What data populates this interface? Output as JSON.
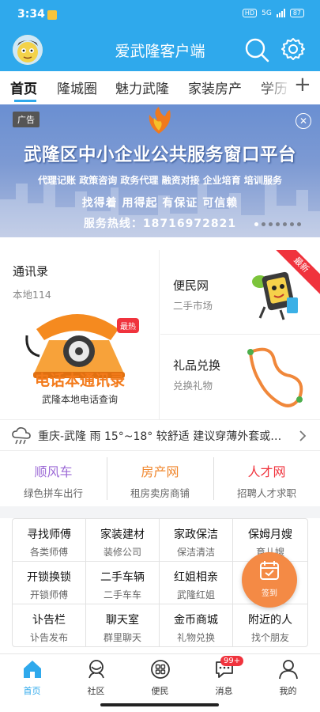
{
  "status_bar": {
    "time": "3:34",
    "network": "HD",
    "signal": "5G",
    "battery": "87"
  },
  "header": {
    "title": "爱武隆客户端"
  },
  "tabs": [
    {
      "label": "首页",
      "active": true
    },
    {
      "label": "隆城圈"
    },
    {
      "label": "魅力武隆"
    },
    {
      "label": "家装房产"
    },
    {
      "label": "学历"
    }
  ],
  "banner": {
    "ad_tag": "广告",
    "title": "武隆区中小企业公共服务窗口平台",
    "services": "代理记账  政策咨询  政务代理  融资对接  企业培育  培训服务",
    "slogan": "找得着 用得起 有保证 可信赖",
    "hotline": "服务热线：18716972821"
  },
  "features": {
    "phonebook": {
      "title": "通讯录",
      "subtitle": "本地114",
      "badge": "最热",
      "banner_title": "电话本通讯录",
      "banner_sub": "武隆本地电话查询"
    },
    "convenience": {
      "title": "便民网",
      "subtitle": "二手市场",
      "ribbon": "最新"
    },
    "gifts": {
      "title": "礼品兑换",
      "subtitle": "兑换礼物"
    }
  },
  "weather": {
    "text": "重庆-武隆 雨 15°~18° 较舒适 建议穿薄外套或…"
  },
  "categories": [
    {
      "title": "顺风车",
      "subtitle": "绿色拼车出行",
      "color": "#9c6ad6"
    },
    {
      "title": "房产网",
      "subtitle": "租房卖房商铺",
      "color": "#f0872e"
    },
    {
      "title": "人才网",
      "subtitle": "招聘人才求职",
      "color": "#f0333d"
    }
  ],
  "services": [
    {
      "title": "寻找师傅",
      "subtitle": "各类师傅"
    },
    {
      "title": "家装建材",
      "subtitle": "装修公司"
    },
    {
      "title": "家政保洁",
      "subtitle": "保洁清洁"
    },
    {
      "title": "保姆月嫂",
      "subtitle": "育儿嫂"
    },
    {
      "title": "开锁换锁",
      "subtitle": "开锁师傅"
    },
    {
      "title": "二手车辆",
      "subtitle": "二手车车"
    },
    {
      "title": "红姐相亲",
      "subtitle": "武隆红姐"
    },
    {
      "title": "",
      "subtitle": ""
    },
    {
      "title": "讣告栏",
      "subtitle": "讣告发布"
    },
    {
      "title": "聊天室",
      "subtitle": "群里聊天"
    },
    {
      "title": "金币商城",
      "subtitle": "礼物兑换"
    },
    {
      "title": "附近的人",
      "subtitle": "找个朋友"
    }
  ],
  "signin": {
    "label": "签到"
  },
  "bottom_nav": [
    {
      "label": "首页",
      "icon": "home-icon",
      "active": true
    },
    {
      "label": "社区",
      "icon": "community-icon"
    },
    {
      "label": "便民",
      "icon": "convenience-icon"
    },
    {
      "label": "消息",
      "icon": "message-icon",
      "badge": "99+"
    },
    {
      "label": "我的",
      "icon": "profile-icon"
    }
  ],
  "colors": {
    "primary": "#2fa9ec",
    "badge_red": "#f0333d",
    "signin_orange": "#f48a45"
  }
}
